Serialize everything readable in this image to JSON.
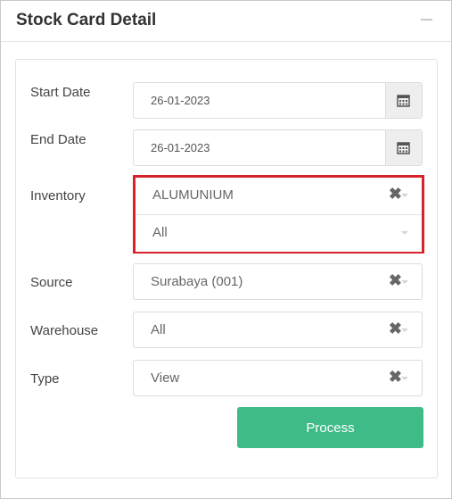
{
  "panel": {
    "title": "Stock Card Detail"
  },
  "form": {
    "start_date": {
      "label": "Start Date",
      "value": "26-01-2023"
    },
    "end_date": {
      "label": "End Date",
      "value": "26-01-2023"
    },
    "inventory": {
      "label": "Inventory",
      "value": "ALUMUNIUM",
      "sub_value": "All"
    },
    "source": {
      "label": "Source",
      "value": "Surabaya (001)"
    },
    "warehouse": {
      "label": "Warehouse",
      "value": "All"
    },
    "type": {
      "label": "Type",
      "value": "View"
    },
    "process_label": "Process"
  },
  "colors": {
    "accent": "#3fbb87",
    "highlight": "#d8232a"
  },
  "icons": {
    "calendar": "calendar-icon",
    "clear": "clear-icon",
    "collapse": "minus-icon"
  }
}
